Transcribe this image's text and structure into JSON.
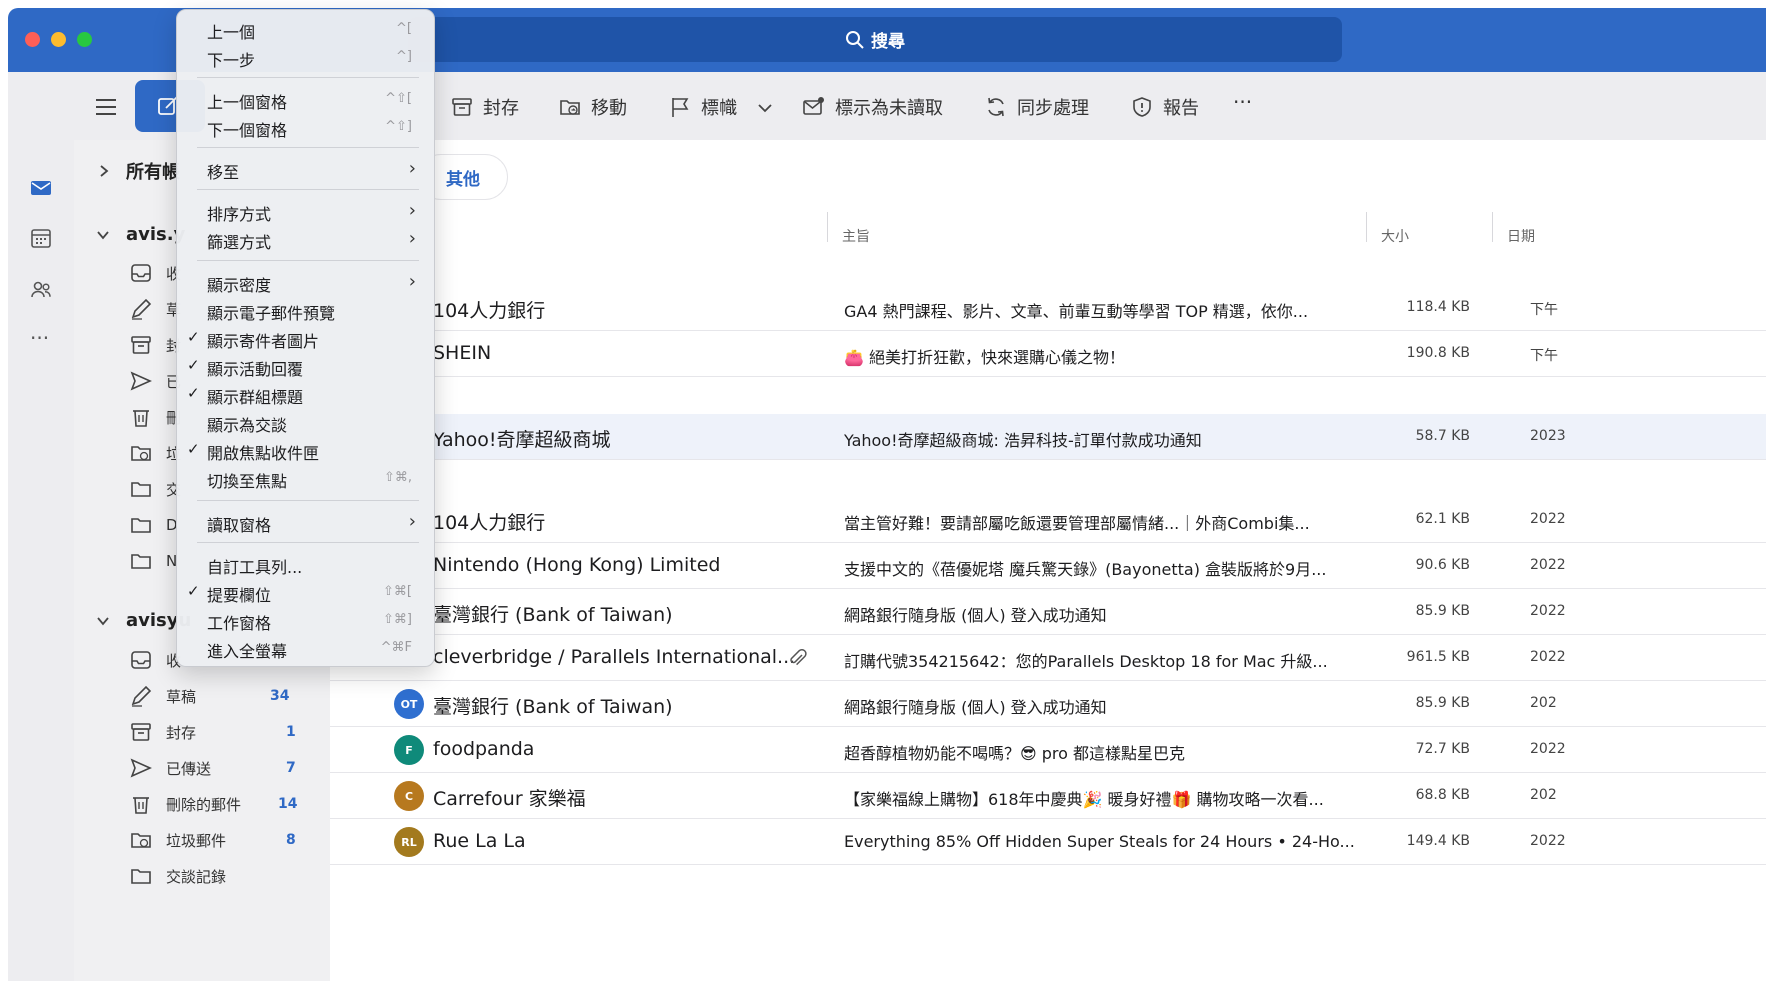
{
  "search": {
    "label": "搜尋"
  },
  "toolbar": {
    "archive": "封存",
    "move": "移動",
    "flag": "標幟",
    "mark_unread": "標示為未讀取",
    "sync": "同步處理",
    "report": "報告",
    "more": "···"
  },
  "rail": {
    "more": "···"
  },
  "sidebar": {
    "all_accounts": "所有帳",
    "account1": "avis.y",
    "account2": "avisyu",
    "account1_items": [
      "收",
      "草",
      "封",
      "已",
      "刪",
      "垃",
      "交",
      "D",
      "N"
    ],
    "account2_items": [
      {
        "label": "收",
        "count": ""
      },
      {
        "label": "草稿",
        "count": "34"
      },
      {
        "label": "封存",
        "count": "1"
      },
      {
        "label": "已傳送",
        "count": "7"
      },
      {
        "label": "刪除的郵件",
        "count": "14"
      },
      {
        "label": "垃圾郵件",
        "count": "8"
      },
      {
        "label": "交談記錄",
        "count": ""
      }
    ]
  },
  "main": {
    "other_pill": "其他",
    "columns": {
      "subject": "主旨",
      "size": "大小",
      "date": "日期"
    },
    "rows": [
      {
        "sender": "104人力銀行",
        "subject": "GA4 熱門課程、影片、文章、前輩互動等學習 TOP 精選，依你...",
        "size": "118.4 KB",
        "date": "下午"
      },
      {
        "sender": "SHEIN",
        "subject": "👛 絕美打折狂歡，快來選購心儀之物！",
        "size": "190.8 KB",
        "date": "下午"
      },
      {
        "sender": "Yahoo!奇摩超級商城",
        "subject": "Yahoo!奇摩超級商城: 浩昇科技-訂單付款成功通知",
        "size": "58.7 KB",
        "date": "2023"
      },
      {
        "sender": "104人力銀行",
        "subject": "當主管好難！要請部屬吃飯還要管理部屬情緒...｜外商Combi集...",
        "size": "62.1 KB",
        "date": "2022"
      },
      {
        "sender": "Nintendo (Hong Kong) Limited",
        "subject": "支援中文的《蓓優妮塔 魔兵驚天錄》(Bayonetta) 盒裝版將於9月...",
        "size": "90.6 KB",
        "date": "2022"
      },
      {
        "sender": "臺灣銀行 (Bank of Taiwan)",
        "subject": "網路銀行隨身版 (個人) 登入成功通知",
        "size": "85.9 KB",
        "date": "2022"
      },
      {
        "sender": "cleverbridge / Parallels International...",
        "subject": "訂購代號354215642：您的Parallels Desktop 18 for Mac 升級...",
        "size": "961.5 KB",
        "date": "2022"
      },
      {
        "sender": "臺灣銀行 (Bank of Taiwan)",
        "avatar": "OT",
        "subject": "網路銀行隨身版 (個人) 登入成功通知",
        "size": "85.9 KB",
        "date": "202"
      },
      {
        "sender": "foodpanda",
        "avatar": "F",
        "subject": "超香醇植物奶能不喝嗎？😎 pro 都這樣點星巴克",
        "size": "72.7 KB",
        "date": "2022"
      },
      {
        "sender": "Carrefour 家樂福",
        "avatar": "C",
        "subject": "【家樂福線上購物】618年中慶典🎉 暖身好禮🎁 購物攻略一次看...",
        "size": "68.8 KB",
        "date": "202"
      },
      {
        "sender": "Rue La La",
        "avatar": "RL",
        "subject": "Everything 85% Off Hidden Super Steals for 24 Hours • 24-Ho...",
        "size": "149.4 KB",
        "date": "2022"
      }
    ]
  },
  "menu": {
    "items": [
      {
        "label": "上一個",
        "shortcut": "^[",
        "check": ""
      },
      {
        "label": "下一步",
        "shortcut": "^]",
        "check": ""
      },
      {
        "label": "上一個窗格",
        "shortcut": "^⇧[",
        "check": ""
      },
      {
        "label": "下一個窗格",
        "shortcut": "^⇧]",
        "check": ""
      },
      {
        "label": "移至",
        "shortcut": "",
        "check": ""
      },
      {
        "label": "排序方式",
        "shortcut": "",
        "check": ""
      },
      {
        "label": "篩選方式",
        "shortcut": "",
        "check": ""
      },
      {
        "label": "顯示密度",
        "shortcut": "",
        "check": ""
      },
      {
        "label": "顯示電子郵件預覽",
        "shortcut": "",
        "check": ""
      },
      {
        "label": "顯示寄件者圖片",
        "shortcut": "",
        "check": "✓"
      },
      {
        "label": "顯示活動回覆",
        "shortcut": "",
        "check": "✓"
      },
      {
        "label": "顯示群組標題",
        "shortcut": "",
        "check": "✓"
      },
      {
        "label": "顯示為交談",
        "shortcut": "",
        "check": ""
      },
      {
        "label": "開啟焦點收件匣",
        "shortcut": "",
        "check": "✓"
      },
      {
        "label": "切換至焦點",
        "shortcut": "⇧⌘,",
        "check": ""
      },
      {
        "label": "讀取窗格",
        "shortcut": "",
        "check": ""
      },
      {
        "label": "自訂工具列...",
        "shortcut": "",
        "check": ""
      },
      {
        "label": "提要欄位",
        "shortcut": "⇧⌘[",
        "check": "✓"
      },
      {
        "label": "工作窗格",
        "shortcut": "⇧⌘]",
        "check": ""
      },
      {
        "label": "進入全螢幕",
        "shortcut": "^⌘F",
        "check": ""
      }
    ]
  },
  "colors": {
    "titlebar": "#2f69c5",
    "accent": "#2f69c5",
    "avatar_ot": "#2f6fd0",
    "avatar_f": "#0f8a7a",
    "avatar_c": "#b7791f",
    "avatar_rl": "#a37a1e"
  }
}
